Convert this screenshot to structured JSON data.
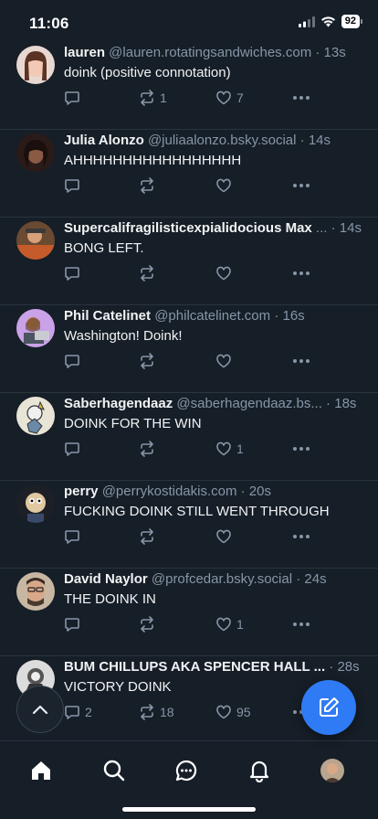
{
  "status": {
    "time": "11:06",
    "battery": "92"
  },
  "posts": [
    {
      "name": "lauren",
      "handle": " @lauren.rotatingsandwiches.com",
      "time": " · 13s",
      "text": "doink (positive connotation)",
      "reposts": "1",
      "likes": "7",
      "avatar": "#e2c9c3"
    },
    {
      "name": "Julia Alonzo",
      "handle": " @juliaalonzo.bsky.social",
      "time": " · 14s",
      "text": "AHHHHHHHHHHHHHHHHH",
      "reposts": "",
      "likes": "",
      "avatar": "#3a2522"
    },
    {
      "name": "Supercalifragilisticexpialidocious Max",
      "handle": " ...",
      "time": " · 14s",
      "text": "BONG LEFT.",
      "reposts": "",
      "likes": "",
      "avatar": "#7a5a3c"
    },
    {
      "name": "Phil Catelinet",
      "handle": " @philcatelinet.com",
      "time": " · 16s",
      "text": "Washington! Doink!",
      "reposts": "",
      "likes": "",
      "avatar": "#c9a2e8"
    },
    {
      "name": "Saberhagendaaz",
      "handle": " @saberhagendaaz.bs...",
      "time": " · 18s",
      "text": "DOINK FOR THE WIN",
      "reposts": "",
      "likes": "1",
      "avatar": "#e8e4d6"
    },
    {
      "name": "perry",
      "handle": " @perrykostidakis.com",
      "time": " · 20s",
      "text": "FUCKING DOINK STILL WENT THROUGH",
      "reposts": "",
      "likes": "",
      "avatar": "#1c2026"
    },
    {
      "name": "David Naylor",
      "handle": " @profcedar.bsky.social",
      "time": " · 24s",
      "text": "THE DOINK IN",
      "reposts": "",
      "likes": "1",
      "avatar": "#b9a58e"
    },
    {
      "name": "BUM CHILLUPS AKA SPENCER HALL ...",
      "handle": "",
      "time": " · 28s",
      "text": "VICTORY DOINK",
      "reposts": "18",
      "likes": "95",
      "replies": "2",
      "avatar": "#d9d9d9"
    }
  ],
  "colors": {
    "background": "#161e27",
    "accent": "#2f7bf5",
    "muted": "#8796a8"
  },
  "icons": {
    "reply": "reply-icon",
    "repost": "repost-icon",
    "like": "heart-icon",
    "more": "more-icon",
    "compose": "compose-icon",
    "home": "home-icon",
    "search": "search-icon",
    "chat": "chat-icon",
    "notifications": "bell-icon"
  }
}
